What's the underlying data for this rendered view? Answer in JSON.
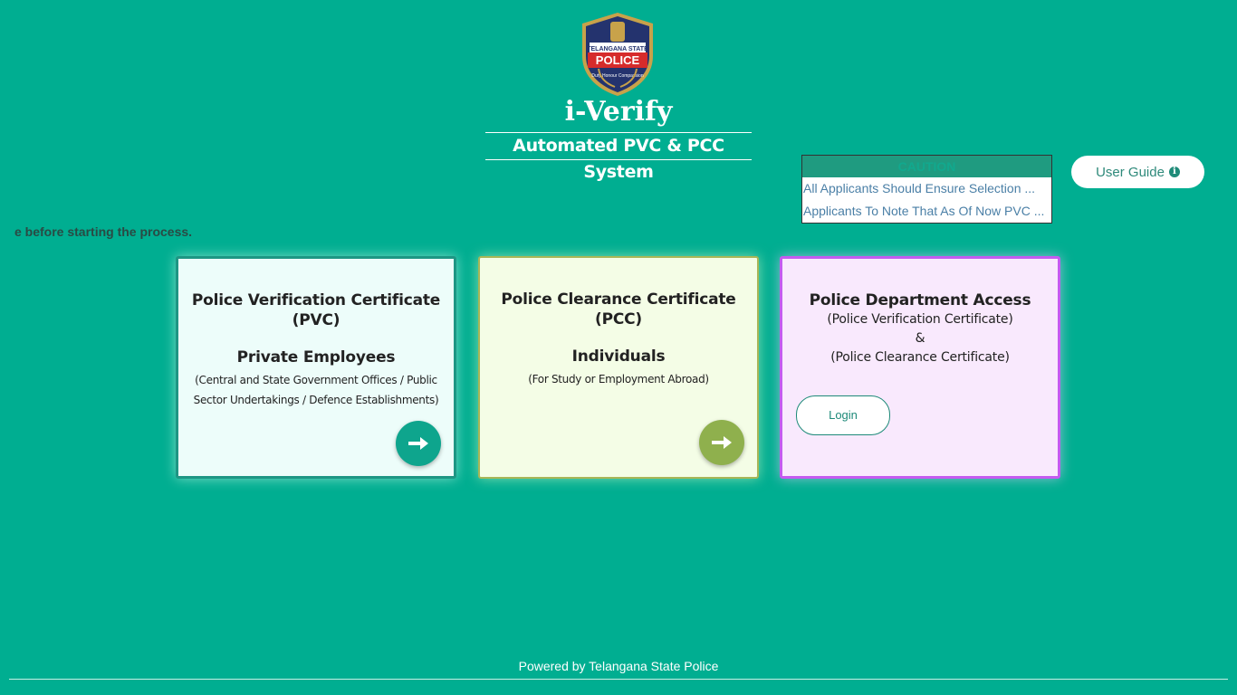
{
  "brand": {
    "badge": {
      "top": "TELANGANA STATE",
      "main": "POLICE",
      "motto": "Duty Honour Compassion"
    },
    "title": "i-Verify",
    "subtitle": "Automated PVC & PCC System"
  },
  "caution": {
    "heading": "CAUTION",
    "items": [
      "All Applicants Should Ensure Selection ...",
      "Applicants To Note That As Of Now PVC ..."
    ]
  },
  "user_guide": {
    "label": "User Guide"
  },
  "marquee": {
    "text": "e before starting the process."
  },
  "cards": {
    "pvc": {
      "title_line1": "Police Verification Certificate",
      "title_line2": "(PVC)",
      "subtitle": "Private Employees",
      "note": "(Central and State Government Offices / Public Sector Undertakings / Defence Establishments)"
    },
    "pcc": {
      "title_line1": "Police Clearance Certificate",
      "title_line2": "(PCC)",
      "subtitle": "Individuals",
      "note": "(For Study or Employment Abroad)"
    },
    "dept": {
      "title": "Police Department Access",
      "line1": "(Police Verification Certificate)",
      "line2": "&",
      "line3": "(Police Clearance Certificate)",
      "login_label": "Login"
    }
  },
  "footer": {
    "text": "Powered by Telangana State Police"
  },
  "colors": {
    "background": "#00ae91",
    "pvc_accent": "#0ea58d",
    "pcc_accent": "#8fb04d",
    "dept_accent": "#c45bf0"
  },
  "icons": {
    "user_guide": "info-circle-icon",
    "card_action": "arrow-right-icon"
  }
}
